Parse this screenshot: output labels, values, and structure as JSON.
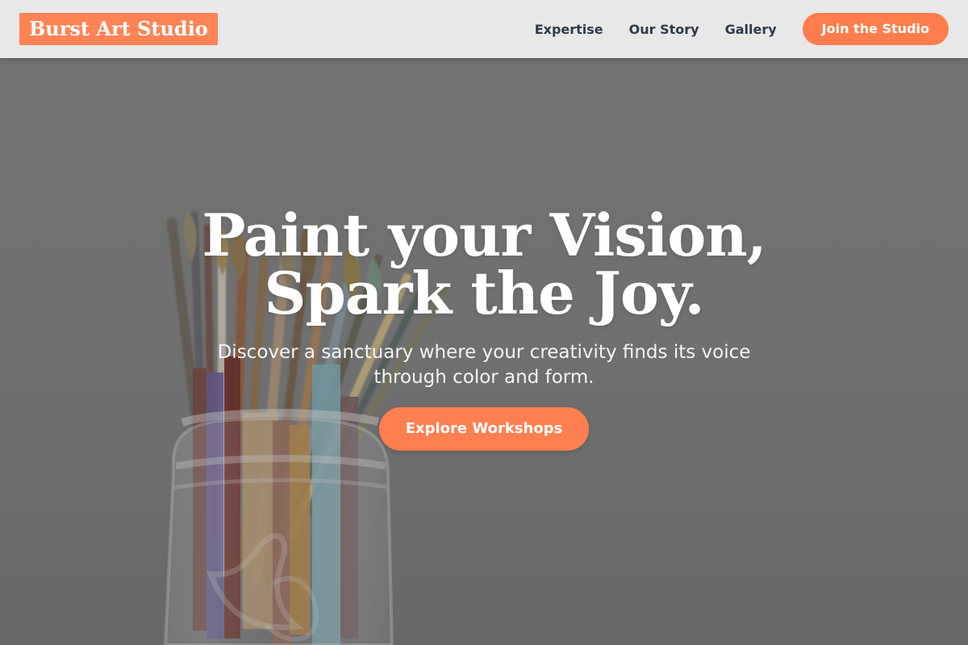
{
  "brand": {
    "name": "Burst Art Studio"
  },
  "nav": {
    "links": [
      {
        "label": "Expertise"
      },
      {
        "label": "Our Story"
      },
      {
        "label": "Gallery"
      }
    ],
    "cta": "Join the Studio"
  },
  "hero": {
    "title_line_1": "Paint your Vision,",
    "title_line_2": "Spark the Joy.",
    "subtitle": "Discover a sanctuary where your creativity finds its voice through color and form.",
    "cta": "Explore Workshops",
    "background_image": "paintbrushes-in-glass-jar"
  },
  "colors": {
    "accent": "#ff7f50",
    "nav_background": "#e8e8e8",
    "nav_text": "#2f3a4a",
    "hero_text": "#ffffff"
  }
}
